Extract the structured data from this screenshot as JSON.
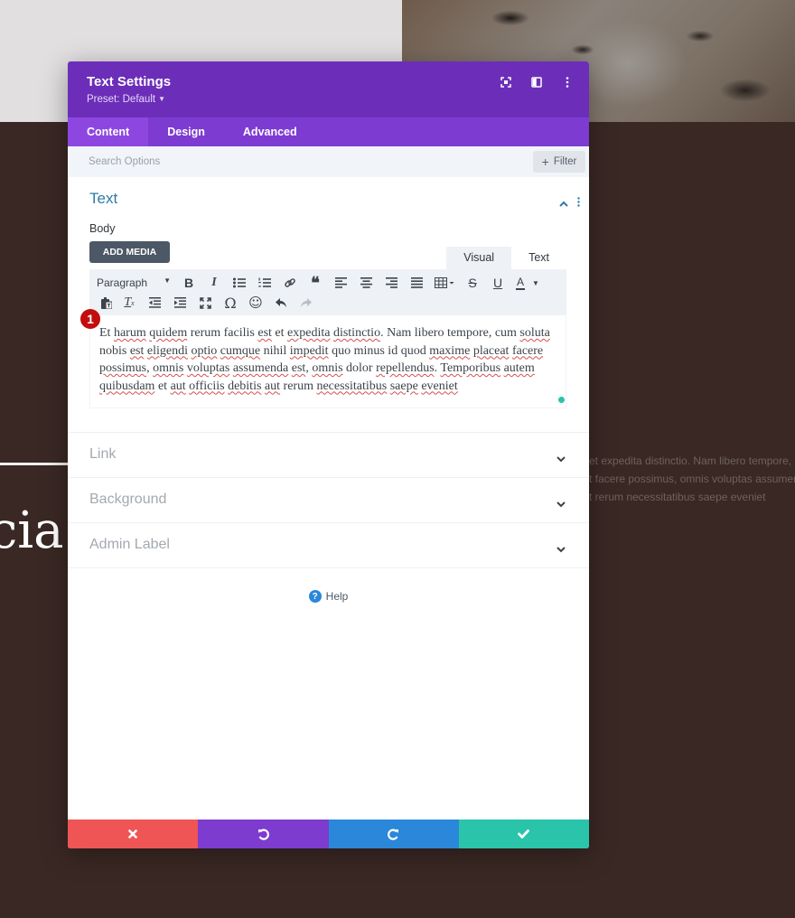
{
  "background": {
    "heading_fragment": "icia",
    "paragraph_lines": [
      "et expedita distinctio. Nam libero tempore,",
      "t facere possimus, omnis voluptas assumer",
      "t rerum necessitatibus saepe eveniet"
    ]
  },
  "modal": {
    "title": "Text Settings",
    "preset": "Preset: Default",
    "header_icons": [
      "fullscreen-icon",
      "split-view-icon",
      "more-options-icon"
    ],
    "tabs": [
      {
        "label": "Content",
        "active": true
      },
      {
        "label": "Design",
        "active": false
      },
      {
        "label": "Advanced",
        "active": false
      }
    ],
    "search": {
      "placeholder": "Search Options",
      "value": ""
    },
    "filter_label": "Filter",
    "text_section": {
      "title": "Text",
      "body_label": "Body",
      "add_media_label": "ADD MEDIA",
      "editor_tabs": [
        "Visual",
        "Text"
      ],
      "toolbar": {
        "format_select": "Paragraph",
        "row1": [
          "bold",
          "italic",
          "bulleted-list",
          "numbered-list",
          "link",
          "blockquote",
          "align-left",
          "align-center",
          "align-right",
          "align-justify",
          "table",
          "strikethrough",
          "underline",
          "text-color"
        ],
        "row2": [
          "paste-as-text",
          "clear-formatting",
          "outdent",
          "indent",
          "fullscreen",
          "special-character",
          "emoji",
          "undo",
          "redo"
        ]
      },
      "badge": "1",
      "content_segments": [
        [
          "Et ",
          false
        ],
        [
          "harum",
          true
        ],
        [
          " ",
          false
        ],
        [
          "quidem",
          true
        ],
        [
          " rerum facilis ",
          false
        ],
        [
          "est",
          true
        ],
        [
          " et ",
          false
        ],
        [
          "expedita",
          true
        ],
        [
          " ",
          false
        ],
        [
          "distinctio",
          true
        ],
        [
          ". Nam libero tempore, cum ",
          false
        ],
        [
          "soluta",
          true
        ],
        [
          " nobis ",
          false
        ],
        [
          "est",
          true
        ],
        [
          " ",
          false
        ],
        [
          "eligendi",
          true
        ],
        [
          " ",
          false
        ],
        [
          "optio",
          true
        ],
        [
          " ",
          false
        ],
        [
          "cumque",
          true
        ],
        [
          " nihil ",
          false
        ],
        [
          "impedit",
          true
        ],
        [
          " quo minus id quod ",
          false
        ],
        [
          "maxime",
          true
        ],
        [
          " ",
          false
        ],
        [
          "placeat",
          true
        ],
        [
          " ",
          false
        ],
        [
          "facere",
          true
        ],
        [
          " ",
          false
        ],
        [
          "possimus",
          true
        ],
        [
          ", ",
          false
        ],
        [
          "omnis",
          true
        ],
        [
          " ",
          false
        ],
        [
          "voluptas",
          true
        ],
        [
          " ",
          false
        ],
        [
          "assumenda",
          true
        ],
        [
          " ",
          false
        ],
        [
          "est",
          true
        ],
        [
          ", ",
          false
        ],
        [
          "omnis",
          true
        ],
        [
          " dolor ",
          false
        ],
        [
          "repellendus",
          true
        ],
        [
          ". ",
          false
        ],
        [
          "Temporibus",
          true
        ],
        [
          " ",
          false
        ],
        [
          "autem",
          true
        ],
        [
          " ",
          false
        ],
        [
          "quibusdam",
          true
        ],
        [
          " et ",
          false
        ],
        [
          "aut",
          true
        ],
        [
          " ",
          false
        ],
        [
          "officiis",
          true
        ],
        [
          " ",
          false
        ],
        [
          "debitis",
          true
        ],
        [
          " ",
          false
        ],
        [
          "aut",
          true
        ],
        [
          " rerum ",
          false
        ],
        [
          "necessitatibus",
          true
        ],
        [
          " ",
          false
        ],
        [
          "saepe",
          true
        ],
        [
          " ",
          false
        ],
        [
          "eveniet",
          true
        ]
      ]
    },
    "collapsed_sections": [
      "Link",
      "Background",
      "Admin Label"
    ],
    "help_label": "Help",
    "footer": {
      "cancel": "cancel-icon",
      "undo": "undo-icon",
      "redo": "redo-icon",
      "save": "save-icon"
    },
    "colors": {
      "header": "#6c2eb9",
      "tabs": "#7d3bd1",
      "active_tab": "#8d47e0",
      "section_title": "#2e7aa8",
      "cancel": "#ef5555",
      "undo": "#7e3bd0",
      "redo": "#2b87da",
      "save": "#29c4a9"
    }
  }
}
